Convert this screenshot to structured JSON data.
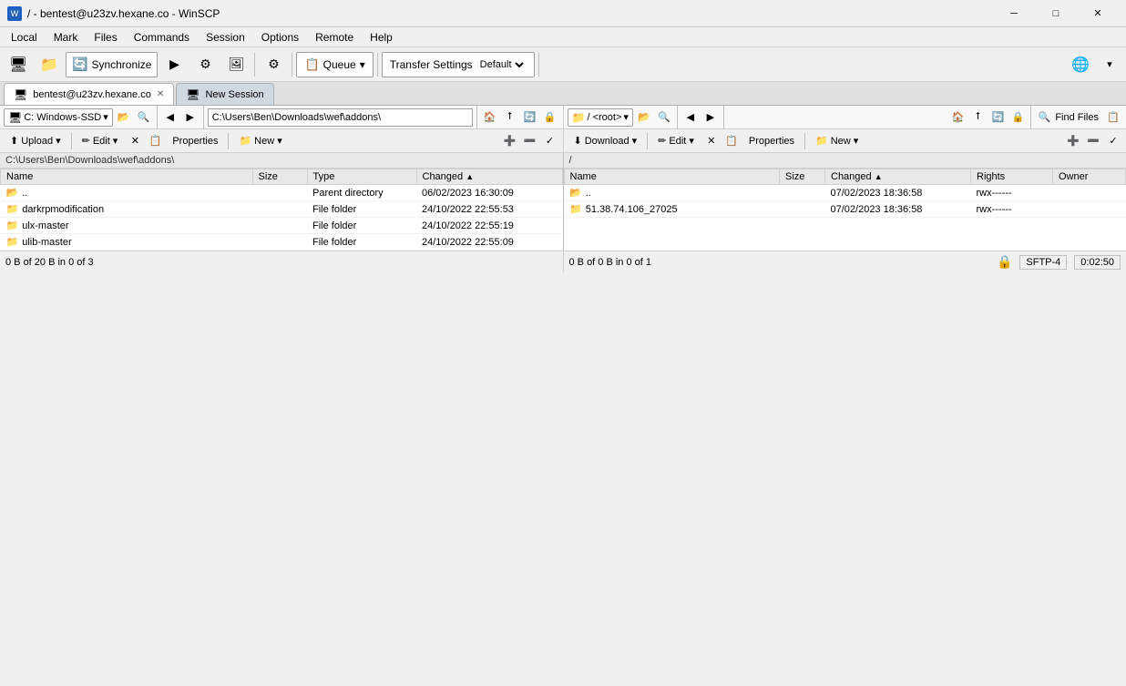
{
  "window": {
    "title": "/ - bentest@u23zv.hexane.co - WinSCP",
    "icon": "W"
  },
  "titlebar": {
    "minimize": "─",
    "maximize": "□",
    "close": "✕"
  },
  "menubar": {
    "items": [
      "Local",
      "Mark",
      "Files",
      "Commands",
      "Session",
      "Options",
      "Remote",
      "Help"
    ]
  },
  "toolbar": {
    "sync_label": "Synchronize",
    "queue_label": "Queue",
    "queue_arrow": "▾",
    "transfer_settings_label": "Transfer Settings",
    "transfer_default": "Default",
    "find_files": "Find Files"
  },
  "tabs": [
    {
      "label": "bentest@u23zv.hexane.co",
      "closable": true,
      "active": true
    },
    {
      "label": "New Session",
      "closable": false,
      "active": false
    }
  ],
  "left_panel": {
    "drive": "C: Windows-SSD",
    "drive_arrow": "▾",
    "path": "C:\\Users\\Ben\\Downloads\\wef\\addons\\",
    "path_bar": "C:\\Users\\Ben\\Downloads\\wef\\addons\\",
    "actions": {
      "upload": "Upload",
      "upload_arrow": "▾",
      "edit": "Edit",
      "edit_arrow": "▾",
      "properties": "Properties",
      "new": "New",
      "new_arrow": "▾"
    },
    "columns": [
      {
        "label": "Name",
        "sort": true
      },
      {
        "label": "Size"
      },
      {
        "label": "Type"
      },
      {
        "label": "Changed",
        "sort_arrow": "▲"
      }
    ],
    "files": [
      {
        "name": "..",
        "icon": "folder-up",
        "size": "",
        "type": "Parent directory",
        "changed": "06/02/2023  16:30:09"
      },
      {
        "name": "darkrpmodification",
        "icon": "folder",
        "size": "",
        "type": "File folder",
        "changed": "24/10/2022  22:55:53"
      },
      {
        "name": "ulx-master",
        "icon": "folder",
        "size": "",
        "type": "File folder",
        "changed": "24/10/2022  22:55:19"
      },
      {
        "name": "ulib-master",
        "icon": "folder",
        "size": "",
        "type": "File folder",
        "changed": "24/10/2022  22:55:09"
      }
    ],
    "status": "0 B of 20 B in 0 of 3"
  },
  "right_panel": {
    "path": "/",
    "path_display": "/ <root>",
    "path_arrow": "▾",
    "actions": {
      "download": "Download",
      "download_arrow": "▾",
      "edit": "Edit",
      "edit_arrow": "▾",
      "properties": "Properties",
      "new": "New",
      "new_arrow": "▾"
    },
    "columns": [
      {
        "label": "Name",
        "sort": true
      },
      {
        "label": "Size"
      },
      {
        "label": "Changed",
        "sort_arrow": "▲"
      },
      {
        "label": "Rights"
      },
      {
        "label": "Owner"
      }
    ],
    "files": [
      {
        "name": "..",
        "icon": "folder-up",
        "size": "",
        "changed": "07/02/2023  18:36:58",
        "rights": "rwx------",
        "owner": ""
      },
      {
        "name": "51.38.74.106_27025",
        "icon": "folder",
        "size": "",
        "changed": "07/02/2023  18:36:58",
        "rights": "rwx------",
        "owner": ""
      }
    ],
    "status": "0 B of 0 B in 0 of 1"
  },
  "statusbar": {
    "lock_icon": "🔒",
    "protocol": "SFTP-4",
    "time": "0:02:50"
  },
  "colors": {
    "folder": "#e8a000",
    "selected_bg": "#0078d7",
    "header_bg": "#e8e8e8",
    "toolbar_bg": "#f0f0f0"
  }
}
